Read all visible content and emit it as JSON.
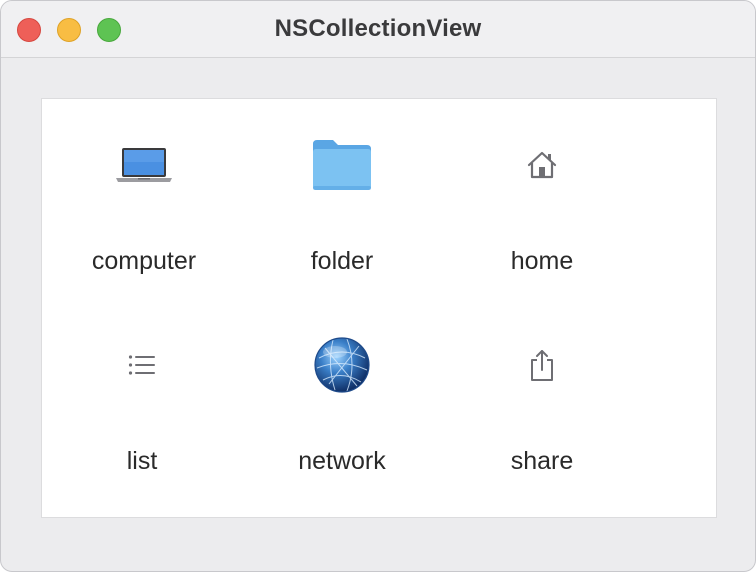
{
  "window": {
    "title": "NSCollectionView"
  },
  "collection": {
    "items": [
      {
        "label": "computer",
        "icon": "laptop-icon"
      },
      {
        "label": "folder",
        "icon": "folder-icon"
      },
      {
        "label": "home",
        "icon": "home-icon"
      },
      {
        "label": "list",
        "icon": "list-icon"
      },
      {
        "label": "network",
        "icon": "network-globe-icon"
      },
      {
        "label": "share",
        "icon": "share-icon"
      }
    ]
  },
  "colors": {
    "close": "#ee5f58",
    "minimize": "#f8bd43",
    "zoom": "#5ec353",
    "folder": "#6cb8ee",
    "glyph": "#6e6e73"
  }
}
